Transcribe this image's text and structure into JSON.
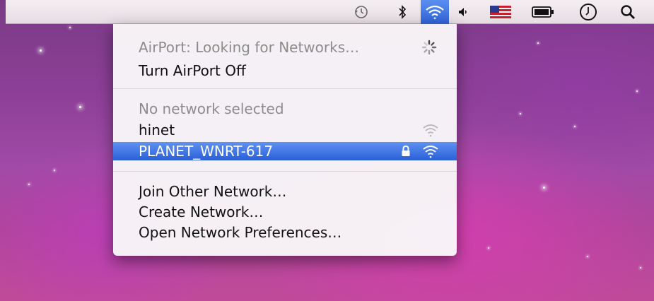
{
  "menubar": {
    "icons": [
      "time-machine-icon",
      "bluetooth-icon",
      "airport-wifi-icon",
      "volume-icon",
      "us-flag-input-icon",
      "battery-icon",
      "clock-icon",
      "spotlight-search-icon"
    ]
  },
  "airport_menu": {
    "status": "AirPort: Looking for Networks…",
    "toggle": "Turn AirPort Off",
    "no_network": "No network selected",
    "networks": [
      {
        "name": "hinet",
        "locked": false,
        "selected": false
      },
      {
        "name": "PLANET_WNRT-617",
        "locked": true,
        "selected": true
      }
    ],
    "join_other": "Join Other Network…",
    "create": "Create Network…",
    "preferences": "Open Network Preferences…"
  },
  "colors": {
    "selection": "#2f63d8",
    "menubar": "#ebe3e8"
  }
}
